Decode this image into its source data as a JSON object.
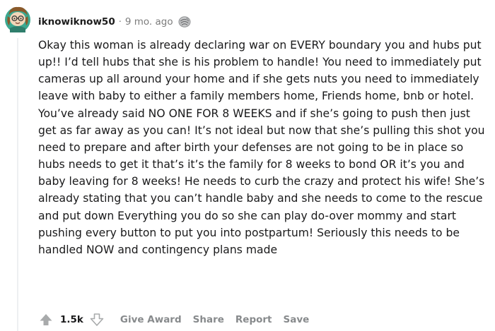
{
  "comment": {
    "username": "iknowiknow50",
    "separator": "·",
    "timestamp": "9 mo. ago",
    "body": "Okay this woman is already declaring war on EVERY boundary you and hubs put up!! I’d tell hubs that she is his problem to handle! You need to immediately put cameras up all around your home and if she gets nuts you need to immediately leave with baby to either a family members home, Friends home, bnb or hotel. You’ve already said NO ONE FOR 8 WEEKS and if she’s going to push then just get as far away as you can! It’s not ideal but now that she’s pulling this shot you need to prepare and after birth your defenses are not going to be in place so hubs needs to get it that’s it’s the family for 8 weeks to bond OR it’s you and baby leaving for 8 weeks! He needs to curb the crazy and protect his wife! She’s already stating that you can’t handle baby and she needs to come to the rescue and put down Everything you do so she can play do-over mommy and start pushing every button to put you into postpartum! Seriously this needs to be handled NOW and contingency plans made"
  },
  "actions": {
    "vote_count": "1.5k",
    "give_award": "Give Award",
    "share": "Share",
    "report": "Report",
    "save": "Save"
  },
  "icons": {
    "avatar": "avatar-icon",
    "award": "award-icon",
    "upvote": "upvote-icon",
    "downvote": "downvote-icon"
  },
  "colors": {
    "text": "#1a1a1b",
    "meta": "#7c7c7c",
    "action": "#878a8c",
    "vote_arrow": "#a8aaab",
    "avatar_green": "#3aa890",
    "avatar_hair": "#8a5a2b"
  }
}
